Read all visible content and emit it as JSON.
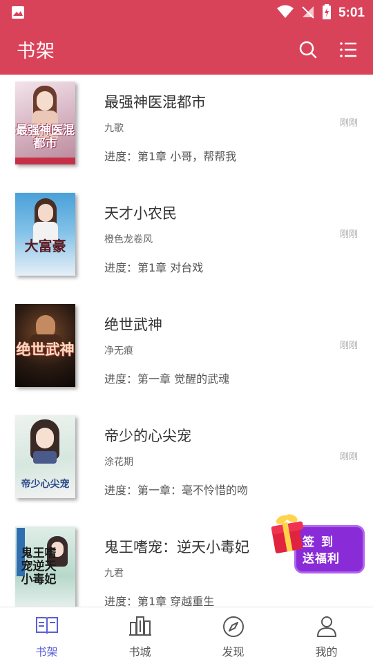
{
  "status_bar": {
    "time": "5:01"
  },
  "app_bar": {
    "title": "书架"
  },
  "books": [
    {
      "title": "最强神医混都市",
      "author": "九歌",
      "progress": "进度：第1章 小哥，帮帮我",
      "time": "刚刚",
      "cover_text": "最强神医混都市"
    },
    {
      "title": "天才小农民",
      "author": "橙色龙卷风",
      "progress": "进度：第1章 对台戏",
      "time": "刚刚",
      "cover_text": "大富豪"
    },
    {
      "title": "绝世武神",
      "author": "净无痕",
      "progress": "进度：第一章 觉醒的武魂",
      "time": "刚刚",
      "cover_text": "绝世武神"
    },
    {
      "title": "帝少的心尖宠",
      "author": "涂花期",
      "progress": "进度：第一章：毫不怜惜的吻",
      "time": "刚刚",
      "cover_text": "帝少心尖宠"
    },
    {
      "title": "鬼王嗜宠：逆天小毒妃",
      "author": "九君",
      "progress": "进度：第1章 穿越重生",
      "time": "",
      "cover_text": "鬼王嗜宠逆天小毒妃"
    }
  ],
  "promo": {
    "line1": "签到",
    "line2": "送福利"
  },
  "tabs": [
    {
      "label": "书架",
      "icon": "book-open-icon",
      "active": true
    },
    {
      "label": "书城",
      "icon": "city-icon",
      "active": false
    },
    {
      "label": "发现",
      "icon": "compass-icon",
      "active": false
    },
    {
      "label": "我的",
      "icon": "person-icon",
      "active": false
    }
  ],
  "colors": {
    "primary": "#d9435a",
    "tab_active": "#5a5fd6"
  }
}
